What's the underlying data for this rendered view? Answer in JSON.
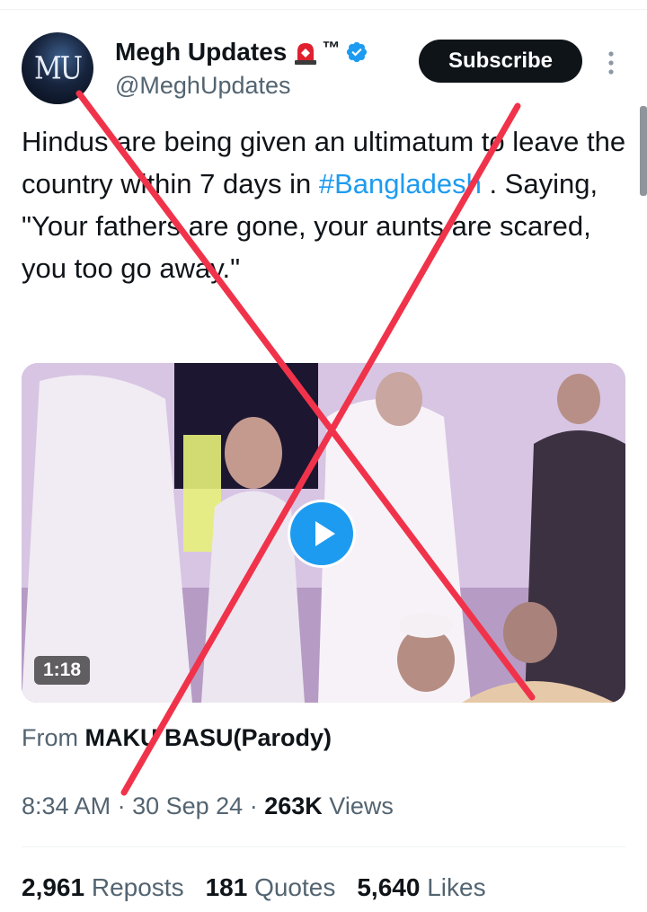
{
  "author": {
    "avatar_text": "MU",
    "display_name": "Megh Updates",
    "trademark": "™",
    "handle": "@MeghUpdates",
    "badge_icon": "siren-icon",
    "verified_icon": "verified-badge-icon",
    "verified_color": "#1d9bf0"
  },
  "header": {
    "subscribe_label": "Subscribe",
    "more_icon": "more-vertical-icon"
  },
  "tweet": {
    "text_part1": "Hindus are being given an ultimatum to leave the country within 7 days in ",
    "hashtag": "#Bangladesh",
    "text_part2": " . Saying, \"Your fathers are gone, your aunts are scared, you too go away.\""
  },
  "media": {
    "duration": "1:18",
    "play_icon": "play-icon"
  },
  "source": {
    "prefix": "From",
    "name": "MAKU BASU(Parody)"
  },
  "meta": {
    "time": "8:34 AM",
    "separator": "·",
    "date": "30 Sep 24",
    "views_count": "263K",
    "views_label": "Views"
  },
  "stats": {
    "reposts_count": "2,961",
    "reposts_label": "Reposts",
    "quotes_count": "181",
    "quotes_label": "Quotes",
    "likes_count": "5,640",
    "likes_label": "Likes"
  },
  "colors": {
    "accent": "#1d9bf0",
    "overlay_x": "#f0334a",
    "text_primary": "#0f1419",
    "text_secondary": "#536471"
  }
}
